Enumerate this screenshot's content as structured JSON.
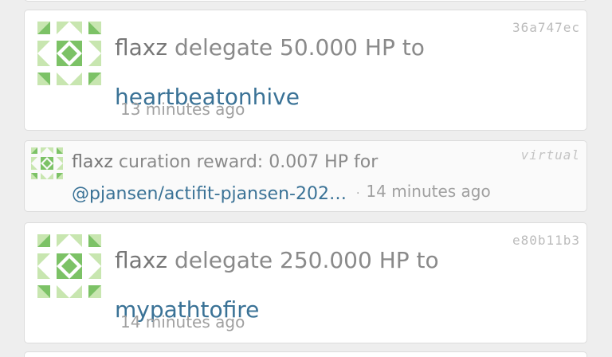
{
  "colors": {
    "link": "#3a7296",
    "avatar_light": "#c8e6b0",
    "avatar_dark": "#7cc266"
  },
  "operations": [
    {
      "tx_id": "36a747ec",
      "user": "flaxz",
      "action": "delegate 50.000 HP to",
      "target": "heartbeatonhive",
      "time": "13 minutes ago",
      "avatar_icon": "identicon-avatar"
    },
    {
      "tx_id": "virtual",
      "user": "flaxz",
      "action": "curation reward: 0.007 HP for",
      "target": "@pjansen/actifit-pjansen-202…",
      "separator": "·",
      "time": "14 minutes ago",
      "avatar_icon": "identicon-avatar"
    },
    {
      "tx_id": "e80b11b3",
      "user": "flaxz",
      "action": "delegate 250.000 HP to",
      "target": "mypathtofire",
      "time": "14 minutes ago",
      "avatar_icon": "identicon-avatar"
    }
  ]
}
